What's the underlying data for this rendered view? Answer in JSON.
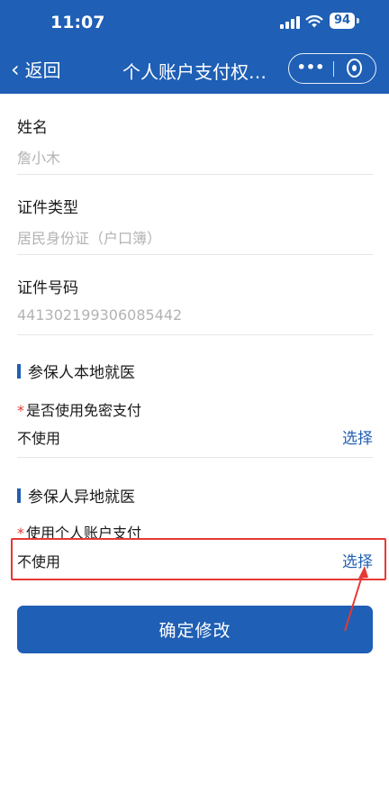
{
  "status": {
    "time": "11:07",
    "battery": "94"
  },
  "nav": {
    "back_label": "返回",
    "title": "个人账户支付权…",
    "more_glyph": "•••"
  },
  "fields": [
    {
      "label": "姓名",
      "value": "詹小木"
    },
    {
      "label": "证件类型",
      "value": "居民身份证（户口簿）"
    },
    {
      "label": "证件号码",
      "value": "441302199306085442"
    }
  ],
  "sections": [
    {
      "title": "参保人本地就医",
      "required_label": "是否使用免密支付",
      "value": "不使用",
      "action": "选择"
    },
    {
      "title": "参保人异地就医",
      "required_label": "使用个人账户支付",
      "value": "不使用",
      "action": "选择"
    }
  ],
  "required_mark": "*",
  "submit_label": "确定修改",
  "colors": {
    "primary": "#1f5fb5",
    "annotation": "#e53935"
  }
}
